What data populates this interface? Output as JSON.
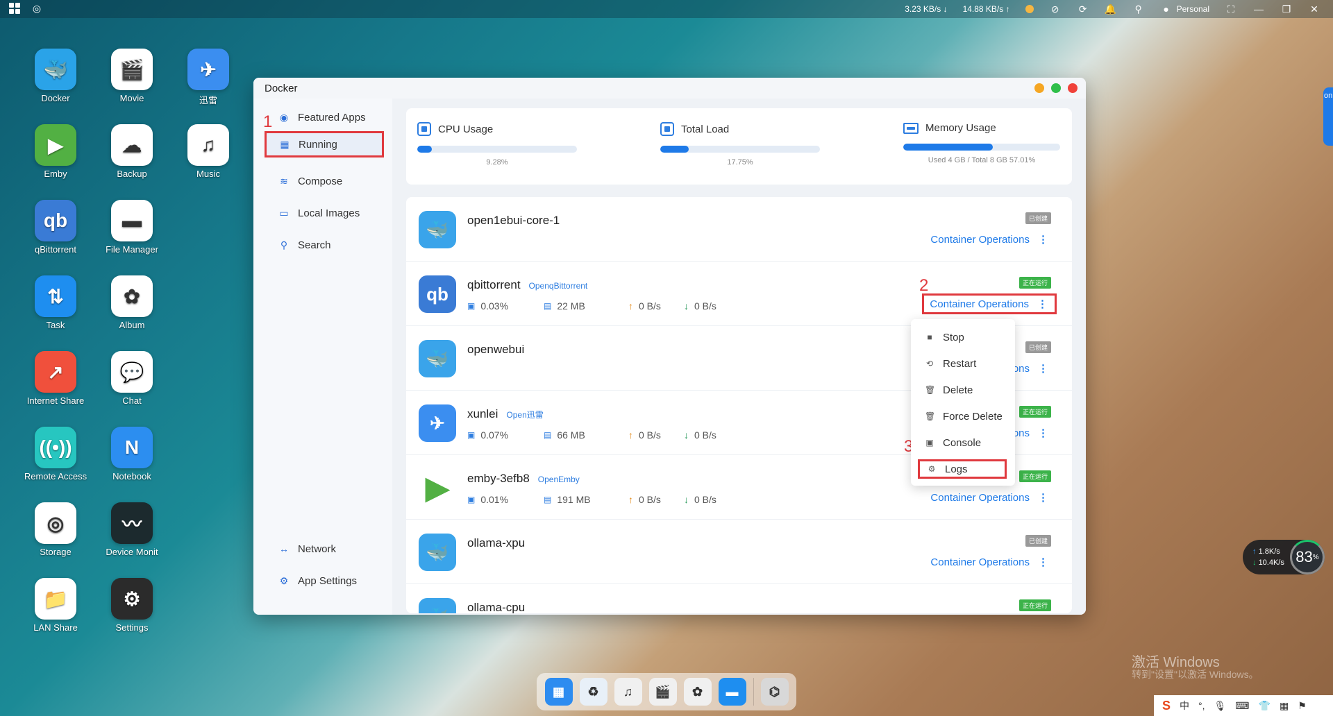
{
  "topbar": {
    "upload_speed": "3.23 KB/s",
    "download_speed": "14.88 KB/s",
    "user": "Personal",
    "icons": [
      "windows-icon",
      "app-center-icon",
      "status-dot",
      "speed-icon",
      "sync-icon",
      "bell-icon",
      "search-icon",
      "user-icon",
      "fullscreen-icon",
      "minimize-icon",
      "restore-icon",
      "close-icon"
    ]
  },
  "desktop": {
    "icons": [
      {
        "label": "Docker",
        "glyph": "🐳",
        "color": "#2aa3e8"
      },
      {
        "label": "Movie",
        "glyph": "🎬",
        "color": "#ffffff"
      },
      {
        "label": "迅雷",
        "glyph": "✈",
        "color": "#3b8ef0"
      },
      {
        "label": "Emby",
        "glyph": "▶",
        "color": "#52b043"
      },
      {
        "label": "Backup",
        "glyph": "☁",
        "color": "#ffffff"
      },
      {
        "label": "Music",
        "glyph": "♫",
        "color": "#ffffff"
      },
      {
        "label": "qBittorrent",
        "glyph": "qb",
        "color": "#3a7bd5"
      },
      {
        "label": "File Manager",
        "glyph": "▬",
        "color": "#ffffff"
      },
      {
        "label": "Task",
        "glyph": "⇅",
        "color": "#1e8ef0"
      },
      {
        "label": "Album",
        "glyph": "✿",
        "color": "#ffffff"
      },
      {
        "label": "Internet Share",
        "glyph": "↗",
        "color": "#f0503c"
      },
      {
        "label": "Chat",
        "glyph": "💬",
        "color": "#ffffff"
      },
      {
        "label": "Remote Access",
        "glyph": "((•))",
        "color": "#27c6c0"
      },
      {
        "label": "Notebook",
        "glyph": "N",
        "color": "#2c8ef0"
      },
      {
        "label": "Storage",
        "glyph": "◎",
        "color": "#ffffff"
      },
      {
        "label": "Device Monit",
        "glyph": "〰",
        "color": "#1c2a2e"
      },
      {
        "label": "LAN Share",
        "glyph": "📁",
        "color": "#ffffff"
      },
      {
        "label": "Settings",
        "glyph": "⚙",
        "color": "#2b2b2b"
      }
    ]
  },
  "window": {
    "title": "Docker",
    "controls": {
      "minimize": "#f5a623",
      "maximize": "#2fbf4a",
      "close": "#f0423a"
    }
  },
  "sidebar": {
    "markers": {
      "step1": "1",
      "step2": "2",
      "step3": "3"
    },
    "items": [
      {
        "label": "Featured Apps",
        "icon": "featured-icon",
        "glyph": "◉"
      },
      {
        "label": "Running",
        "icon": "running-icon",
        "glyph": "▦"
      },
      {
        "label": "Compose",
        "icon": "compose-icon",
        "glyph": "≋"
      },
      {
        "label": "Local Images",
        "icon": "local-images-icon",
        "glyph": "▭"
      },
      {
        "label": "Search",
        "icon": "search-icon",
        "glyph": "⚲"
      }
    ],
    "bottom_items": [
      {
        "label": "Network",
        "icon": "network-icon",
        "glyph": "↔"
      },
      {
        "label": "App Settings",
        "icon": "app-settings-icon",
        "glyph": "⚙"
      }
    ]
  },
  "stats": {
    "cpu": {
      "label": "CPU Usage",
      "value": "9.28%",
      "percent": 9.28
    },
    "load": {
      "label": "Total Load",
      "value": "17.75%",
      "percent": 17.75
    },
    "memory": {
      "label": "Memory Usage",
      "value": "Used 4 GB / Total 8 GB  57.01%",
      "percent": 57.01
    }
  },
  "containers": [
    {
      "name": "open1ebui-core-1",
      "tag": "",
      "status": "已创建",
      "status_type": "created",
      "ops": "Container Operations",
      "logo": "🐳",
      "logo_color": "#3aa4ea",
      "metrics": null
    },
    {
      "name": "qbittorrent",
      "tag": "OpenqBittorrent",
      "status": "正在运行",
      "status_type": "running",
      "ops": "Container Operations",
      "logo": "qb",
      "logo_color": "#3a7bd5",
      "metrics": {
        "cpu": "0.03%",
        "mem": "22 MB",
        "up": "0 B/s",
        "down": "0 B/s"
      }
    },
    {
      "name": "openwebui",
      "tag": "",
      "status": "已创建",
      "status_type": "created",
      "ops": "tions",
      "logo": "🐳",
      "logo_color": "#3aa4ea",
      "metrics": null
    },
    {
      "name": "xunlei",
      "tag": "Open迅雷",
      "status": "正在运行",
      "status_type": "running",
      "ops": "tions",
      "logo": "✈",
      "logo_color": "#3b8ef0",
      "metrics": {
        "cpu": "0.07%",
        "mem": "66 MB",
        "up": "0 B/s",
        "down": "0 B/s"
      }
    },
    {
      "name": "emby-3efb8",
      "tag": "OpenEmby",
      "status": "正在运行",
      "status_type": "running",
      "ops": "Container Operations",
      "logo": "▶",
      "logo_color": "#52b043",
      "metrics": {
        "cpu": "0.01%",
        "mem": "191 MB",
        "up": "0 B/s",
        "down": "0 B/s"
      }
    },
    {
      "name": "ollama-xpu",
      "tag": "",
      "status": "已创建",
      "status_type": "created",
      "ops": "Container Operations",
      "logo": "🐳",
      "logo_color": "#3aa4ea",
      "metrics": null
    },
    {
      "name": "ollama-cpu",
      "tag": "",
      "status": "正在运行",
      "status_type": "running",
      "ops": "",
      "logo": "🐳",
      "logo_color": "#3aa4ea",
      "metrics": null
    }
  ],
  "dropdown": {
    "items": [
      {
        "label": "Stop",
        "icon": "stop-icon",
        "glyph": "■"
      },
      {
        "label": "Restart",
        "icon": "restart-icon",
        "glyph": "⟲"
      },
      {
        "label": "Delete",
        "icon": "delete-icon",
        "glyph": "🗑"
      },
      {
        "label": "Force Delete",
        "icon": "force-delete-icon",
        "glyph": "🗑"
      },
      {
        "label": "Console",
        "icon": "console-icon",
        "glyph": "▣"
      },
      {
        "label": "Logs",
        "icon": "logs-icon",
        "glyph": "⚙"
      }
    ]
  },
  "dock": {
    "items": [
      {
        "name": "app-center",
        "glyph": "▦",
        "color": "#2d8cf0"
      },
      {
        "name": "recycle",
        "glyph": "♻",
        "color": "#e8f0f8"
      },
      {
        "name": "music",
        "glyph": "♫",
        "color": "#f0f0f0"
      },
      {
        "name": "movie",
        "glyph": "🎬",
        "color": "#f0f0f0"
      },
      {
        "name": "album",
        "glyph": "✿",
        "color": "#f0f0f0"
      },
      {
        "name": "file-manager",
        "glyph": "▬",
        "color": "#1e8ef0"
      },
      {
        "name": "device-monitor",
        "glyph": "⌬",
        "color": "#d8d8d8"
      }
    ]
  },
  "watermark": {
    "line1": "激活 Windows",
    "line2": "转到\"设置\"以激活 Windows。"
  },
  "netwidget": {
    "up": "1.8K/s",
    "down": "10.4K/s",
    "percent": "83",
    "unit": "%"
  },
  "tray": {
    "ime": "中",
    "items": [
      "S",
      "中",
      "°,",
      "🎙",
      "⌨",
      "👕",
      "▦",
      "⚑"
    ]
  },
  "edge_tab": {
    "text": "on"
  }
}
